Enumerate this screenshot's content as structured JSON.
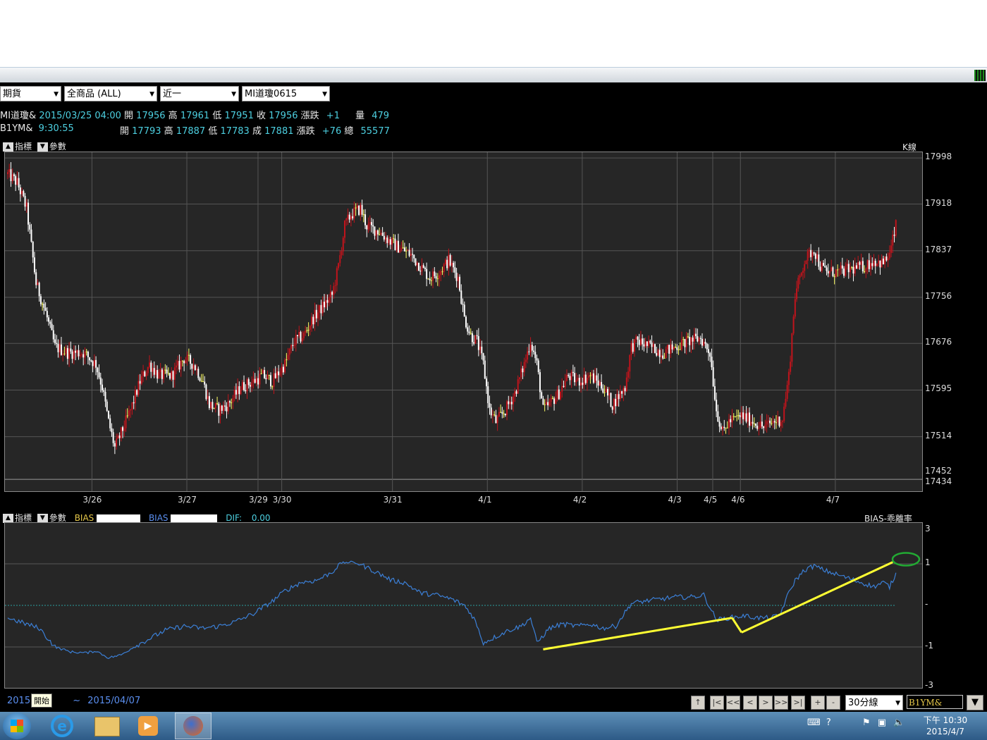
{
  "toolbar": {
    "market_select": "期貨",
    "product_select": "全商品 (ALL)",
    "period_select": "近一",
    "symbol_select": "MI道瓊0615"
  },
  "quote_line1": {
    "symbol": "MI道瓊&",
    "datetime": "2015/03/25 04:00",
    "open_label": "開",
    "open": "17956",
    "high_label": "高",
    "high": "17961",
    "low_label": "低",
    "low": "17951",
    "close_label": "收",
    "close": "17956",
    "change_label": "漲跌",
    "change": "+1",
    "volume_label": "量",
    "volume": "479"
  },
  "quote_line2": {
    "symbol": "B1YM&",
    "time": "9:30:55",
    "open_label": "開",
    "open": "17793",
    "high_label": "高",
    "high": "17887",
    "low_label": "低",
    "low": "17783",
    "trade_label": "成",
    "trade": "17881",
    "change_label": "漲跌",
    "change": "+76",
    "total_label": "總",
    "total": "55577"
  },
  "main_panel": {
    "indicator_label": "指標",
    "param_label": "參數",
    "chart_name": "K線"
  },
  "sub_panel": {
    "indicator_label": "指標",
    "param_label": "參數",
    "bias1_label": "BIAS",
    "bias2_label": "BIAS",
    "dif_label": "DIF:",
    "dif_value": "0.00",
    "chart_name": "BIAS-乖離率"
  },
  "footer": {
    "date_start": "2015",
    "start_tooltip": "開始",
    "tilde": "~",
    "date_end": "2015/04/07",
    "interval_select": "30分線",
    "symbol_input": "B1YM&"
  },
  "nav_buttons": [
    "↑",
    "|<",
    "<<",
    "<",
    ">",
    ">>",
    ">|",
    "+",
    "-"
  ],
  "taskbar": {
    "time": "下午 10:30",
    "date": "2015/4/7"
  },
  "colors": {
    "up": "#c0141c",
    "down": "#ffffff",
    "doji": "#ffff66",
    "bias_line": "#3b7fd6",
    "annotation": "#ffff33",
    "circle": "#22aa33"
  },
  "chart_data": [
    {
      "type": "candlestick",
      "title": "K線",
      "y_ticks": [
        17998,
        17918,
        17837,
        17756,
        17676,
        17595,
        17514,
        17452,
        17434
      ],
      "ylim": [
        17434,
        18008
      ],
      "x_ticks": [
        "3/26",
        "3/27",
        "3/29",
        "3/30",
        "3/31",
        "4/1",
        "4/2",
        "4/3",
        "4/5",
        "4/6",
        "4/7"
      ],
      "close_path": [
        [
          0,
          17970
        ],
        [
          6,
          17955
        ],
        [
          12,
          17910
        ],
        [
          18,
          17780
        ],
        [
          24,
          17730
        ],
        [
          30,
          17670
        ],
        [
          38,
          17660
        ],
        [
          48,
          17660
        ],
        [
          56,
          17640
        ],
        [
          60,
          17600
        ],
        [
          64,
          17540
        ],
        [
          68,
          17495
        ],
        [
          72,
          17520
        ],
        [
          78,
          17560
        ],
        [
          84,
          17610
        ],
        [
          90,
          17640
        ],
        [
          96,
          17620
        ],
        [
          104,
          17620
        ],
        [
          112,
          17650
        ],
        [
          118,
          17640
        ],
        [
          124,
          17610
        ],
        [
          128,
          17570
        ],
        [
          134,
          17560
        ],
        [
          140,
          17570
        ],
        [
          148,
          17600
        ],
        [
          156,
          17610
        ],
        [
          162,
          17620
        ],
        [
          168,
          17610
        ],
        [
          176,
          17640
        ],
        [
          182,
          17680
        ],
        [
          188,
          17690
        ],
        [
          194,
          17720
        ],
        [
          200,
          17740
        ],
        [
          206,
          17760
        ],
        [
          210,
          17810
        ],
        [
          214,
          17880
        ],
        [
          218,
          17900
        ],
        [
          224,
          17910
        ],
        [
          228,
          17880
        ],
        [
          236,
          17870
        ],
        [
          244,
          17850
        ],
        [
          250,
          17840
        ],
        [
          256,
          17830
        ],
        [
          262,
          17810
        ],
        [
          268,
          17790
        ],
        [
          274,
          17800
        ],
        [
          280,
          17820
        ],
        [
          286,
          17790
        ],
        [
          290,
          17720
        ],
        [
          294,
          17690
        ],
        [
          298,
          17680
        ],
        [
          302,
          17640
        ],
        [
          306,
          17560
        ],
        [
          310,
          17540
        ],
        [
          316,
          17560
        ],
        [
          322,
          17590
        ],
        [
          328,
          17640
        ],
        [
          332,
          17680
        ],
        [
          336,
          17640
        ],
        [
          340,
          17560
        ],
        [
          344,
          17570
        ],
        [
          350,
          17590
        ],
        [
          356,
          17620
        ],
        [
          362,
          17610
        ],
        [
          370,
          17620
        ],
        [
          378,
          17600
        ],
        [
          384,
          17570
        ],
        [
          392,
          17600
        ],
        [
          396,
          17670
        ],
        [
          400,
          17680
        ],
        [
          408,
          17670
        ],
        [
          416,
          17660
        ],
        [
          424,
          17670
        ],
        [
          432,
          17680
        ],
        [
          440,
          17685
        ],
        [
          446,
          17660
        ],
        [
          450,
          17560
        ],
        [
          454,
          17520
        ],
        [
          458,
          17540
        ],
        [
          466,
          17550
        ],
        [
          474,
          17540
        ],
        [
          480,
          17530
        ],
        [
          486,
          17540
        ],
        [
          492,
          17545
        ],
        [
          496,
          17620
        ],
        [
          500,
          17760
        ],
        [
          506,
          17820
        ],
        [
          512,
          17840
        ],
        [
          516,
          17810
        ],
        [
          520,
          17800
        ],
        [
          528,
          17800
        ],
        [
          536,
          17805
        ],
        [
          544,
          17810
        ],
        [
          550,
          17820
        ],
        [
          556,
          17815
        ],
        [
          560,
          17830
        ],
        [
          564,
          17880
        ]
      ],
      "x_count": 565
    },
    {
      "type": "line",
      "title": "BIAS-乖離率",
      "y_ticks": [
        3,
        1,
        0,
        -1,
        -3
      ],
      "ylim": [
        -3,
        3
      ],
      "series": [
        {
          "name": "BIAS",
          "values_path": [
            [
              0,
              -0.3
            ],
            [
              20,
              -0.55
            ],
            [
              30,
              -1.0
            ],
            [
              40,
              -1.25
            ],
            [
              50,
              -1.3
            ],
            [
              56,
              -1.2
            ],
            [
              64,
              -1.55
            ],
            [
              72,
              -1.4
            ],
            [
              80,
              -1.0
            ],
            [
              90,
              -0.8
            ],
            [
              100,
              -0.6
            ],
            [
              112,
              -0.5
            ],
            [
              124,
              -0.55
            ],
            [
              134,
              -0.5
            ],
            [
              144,
              -0.4
            ],
            [
              156,
              -0.2
            ],
            [
              168,
              0.1
            ],
            [
              176,
              0.35
            ],
            [
              186,
              0.55
            ],
            [
              196,
              0.6
            ],
            [
              206,
              0.8
            ],
            [
              212,
              1.05
            ],
            [
              218,
              1.1
            ],
            [
              226,
              0.95
            ],
            [
              234,
              0.8
            ],
            [
              244,
              0.6
            ],
            [
              252,
              0.55
            ],
            [
              262,
              0.3
            ],
            [
              272,
              0.25
            ],
            [
              282,
              0.15
            ],
            [
              290,
              0.0
            ],
            [
              296,
              -0.3
            ],
            [
              302,
              -0.9
            ],
            [
              310,
              -0.75
            ],
            [
              318,
              -0.6
            ],
            [
              326,
              -0.5
            ],
            [
              332,
              -0.3
            ],
            [
              336,
              -0.9
            ],
            [
              344,
              -0.55
            ],
            [
              352,
              -0.45
            ],
            [
              362,
              -0.5
            ],
            [
              370,
              -0.45
            ],
            [
              378,
              -0.55
            ],
            [
              386,
              -0.5
            ],
            [
              396,
              0.05
            ],
            [
              404,
              0.1
            ],
            [
              414,
              0.15
            ],
            [
              424,
              0.2
            ],
            [
              434,
              0.2
            ],
            [
              442,
              0.25
            ],
            [
              450,
              -0.35
            ],
            [
              458,
              -0.3
            ],
            [
              468,
              -0.25
            ],
            [
              476,
              -0.3
            ],
            [
              484,
              -0.3
            ],
            [
              490,
              -0.25
            ],
            [
              496,
              0.3
            ],
            [
              500,
              0.6
            ],
            [
              506,
              0.85
            ],
            [
              512,
              0.95
            ],
            [
              518,
              0.85
            ],
            [
              526,
              0.75
            ],
            [
              534,
              0.65
            ],
            [
              542,
              0.55
            ],
            [
              550,
              0.45
            ],
            [
              556,
              0.55
            ],
            [
              560,
              0.45
            ],
            [
              564,
              0.75
            ]
          ]
        }
      ],
      "annotations": [
        {
          "type": "line",
          "from": [
            340,
            -1.12
          ],
          "to": [
            460,
            -0.3
          ]
        },
        {
          "type": "line",
          "from": [
            460,
            -0.3
          ],
          "to": [
            466,
            -0.65
          ]
        },
        {
          "type": "line",
          "from": [
            466,
            -0.65
          ],
          "to": [
            562,
            1.1
          ]
        }
      ],
      "x_count": 565
    }
  ]
}
